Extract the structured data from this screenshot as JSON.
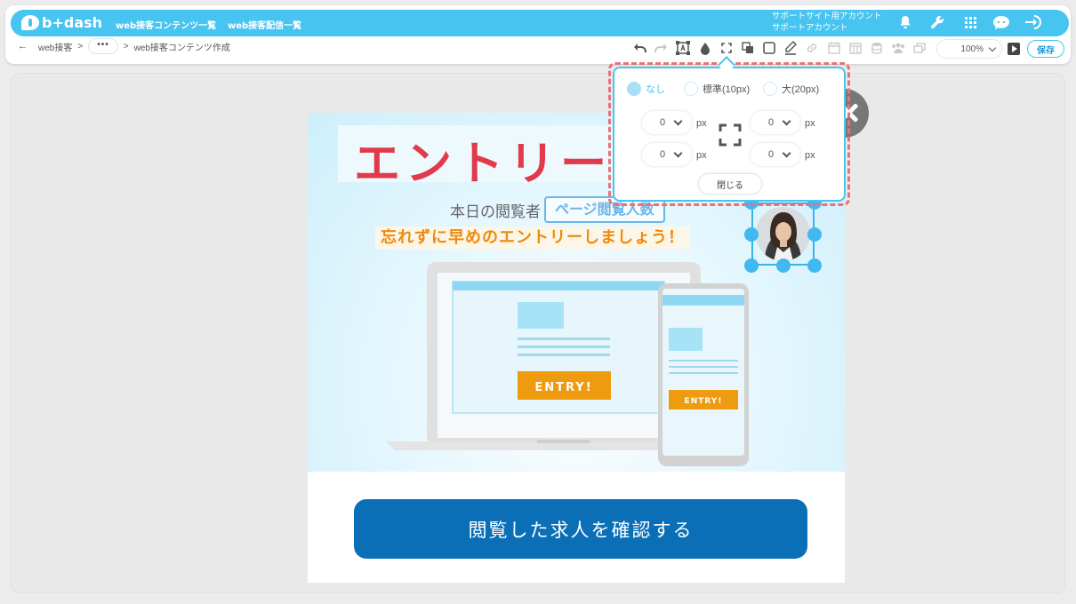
{
  "app": {
    "logo_text": "b+dash"
  },
  "header": {
    "nav": [
      "web接客コンテンツ一覧",
      "web接客配信一覧"
    ],
    "account_line1": "サポートサイト用アカウント",
    "account_line2": "サポートアカウント",
    "icons": [
      "bell-icon",
      "wrench-icon",
      "grid-icon",
      "chat-icon",
      "logout-icon"
    ]
  },
  "breadcrumb": {
    "back_arrow": "←",
    "root": "web接客",
    "sep1": ">",
    "more": "•••",
    "sep2": ">",
    "current": "web接客コンテンツ作成"
  },
  "toolbar": {
    "tools": [
      "undo-icon",
      "redo-icon",
      "text-frame-icon",
      "fill-color-icon",
      "padding-icon",
      "layer-order-icon",
      "border-icon",
      "pen-icon",
      "link-icon",
      "calendar-icon",
      "table-icon",
      "database-icon",
      "users-icon",
      "copy-icon"
    ],
    "zoom": "100%",
    "save_label": "保存"
  },
  "colors": {
    "accent": "#48c4f0",
    "cta": "#0a6fb7",
    "title_red": "#e03a4b",
    "orange": "#f08a0c",
    "dash_red": "#ec6f79"
  },
  "content": {
    "title": "エントリー",
    "viewer_prefix": "本日の閲覧者",
    "viewer_tag": "ページ閲覧人数",
    "reminder": "忘れずに早めのエントリーしましょう！",
    "entry_label": "ENTRY!",
    "cta_label": "閲覧した求人を確認する"
  },
  "padding_popover": {
    "options": [
      {
        "label": "なし",
        "selected": true
      },
      {
        "label": "標準(10px)",
        "selected": false
      },
      {
        "label": "大(20px)",
        "selected": false
      }
    ],
    "top_left": "0",
    "top_right": "0",
    "bottom_left": "0",
    "bottom_right": "0",
    "unit": "px",
    "close_label": "閉じる"
  }
}
